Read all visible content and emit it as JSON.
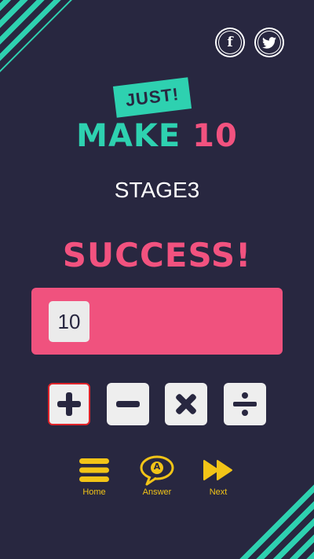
{
  "social": {
    "facebook_glyph": "f",
    "twitter_icon": "twitter-bird-icon"
  },
  "logo": {
    "just": "JUST!",
    "make": "MAKE",
    "number": "10"
  },
  "stage": "STAGE3",
  "result": "SUCCESS!",
  "answer_tiles": [
    "10"
  ],
  "operators": [
    {
      "symbol": "+",
      "icon": "plus-icon",
      "selected": true
    },
    {
      "symbol": "−",
      "icon": "minus-icon",
      "selected": false
    },
    {
      "symbol": "×",
      "icon": "times-icon",
      "selected": false
    },
    {
      "symbol": "÷",
      "icon": "divide-icon",
      "selected": false
    }
  ],
  "nav": {
    "home": "Home",
    "answer": "Answer",
    "answer_badge": "A",
    "next": "Next"
  },
  "colors": {
    "background": "#282740",
    "teal": "#2ED1B0",
    "pink": "#F2527F",
    "yellow": "#F2C417",
    "tile": "#EBEBEB"
  }
}
